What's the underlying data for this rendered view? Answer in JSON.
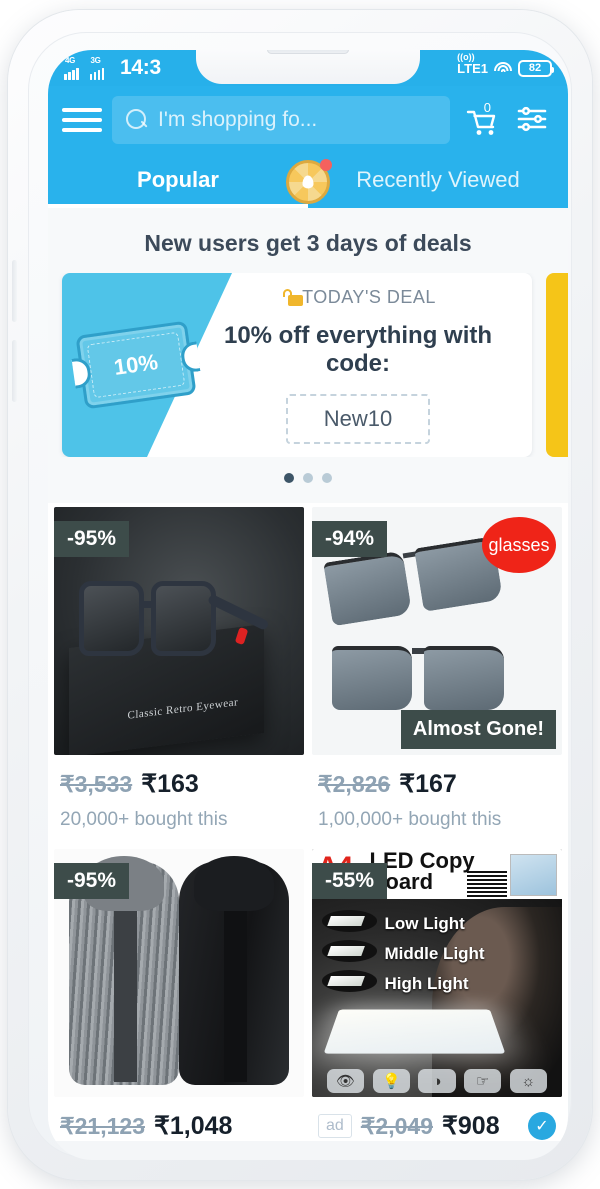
{
  "status_bar": {
    "network_1": "4G",
    "network_2": "3G",
    "time": "14:3",
    "carrier": "LTE1",
    "battery": "82",
    "wifi_icon": "wifi-icon",
    "signal_icon": "signal-bars-icon"
  },
  "header": {
    "menu_icon": "hamburger-menu-icon",
    "search_placeholder": "I'm shopping fo...",
    "search_value": "",
    "search_icon": "search-icon",
    "cart_icon": "shopping-cart-icon",
    "cart_count": "0",
    "filter_icon": "filter-sliders-icon"
  },
  "tabs": {
    "items": [
      {
        "label": "Popular",
        "active": true
      },
      {
        "label": "Recently Viewed",
        "active": false
      }
    ],
    "spinner_icon": "prize-wheel-icon",
    "spinner_badge": "notification-dot"
  },
  "promo": {
    "title": "New users get 3 days of deals",
    "deal": {
      "ticket_label": "10%",
      "lock_icon": "lock-icon",
      "kicker": "TODAY'S DEAL",
      "headline": "10% off everything with code:",
      "code": "New10"
    },
    "dots": {
      "count": 3,
      "active_index": 0
    }
  },
  "products": [
    {
      "name": "classic-retro-sunglasses",
      "discount": "-95%",
      "price_old": "₹3,533",
      "price_new": "₹163",
      "bought": "20,000+ bought this",
      "image_caption": "Classic Retro Eyewear",
      "art": "art1"
    },
    {
      "name": "polarized-aviator-sunglasses",
      "discount": "-94%",
      "round_label": "glasses",
      "overlay_label": "Almost Gone!",
      "price_old": "₹2,826",
      "price_new": "₹167",
      "bought": "1,00,000+ bought this",
      "art": "art2"
    },
    {
      "name": "hooded-cardigan-jacket",
      "discount": "-95%",
      "price_old": "₹21,123",
      "price_new": "₹1,048",
      "art": "art3"
    },
    {
      "name": "a4-led-copy-board",
      "discount": "-55%",
      "ad_tag": "ad",
      "price_old": "₹2,049",
      "price_new": "₹908",
      "verified_icon": "verified-check-icon",
      "image_text": {
        "brand": "A4",
        "title_line1": "LED Copy",
        "title_line2": "Board",
        "labels": [
          "Low Light",
          "Middle Light",
          "High Light"
        ],
        "feature_icons": [
          "eye-icon",
          "bulb-icon",
          "dimmer-icon",
          "touch-icon",
          "brightness-icon"
        ]
      },
      "art": "art4"
    }
  ],
  "colors": {
    "brand_blue": "#29b2ec",
    "badge_dark": "#3d4c4a",
    "accent_red": "#ef2418",
    "deal_yellow": "#f5c518",
    "price_old": "#8ea2b3"
  }
}
